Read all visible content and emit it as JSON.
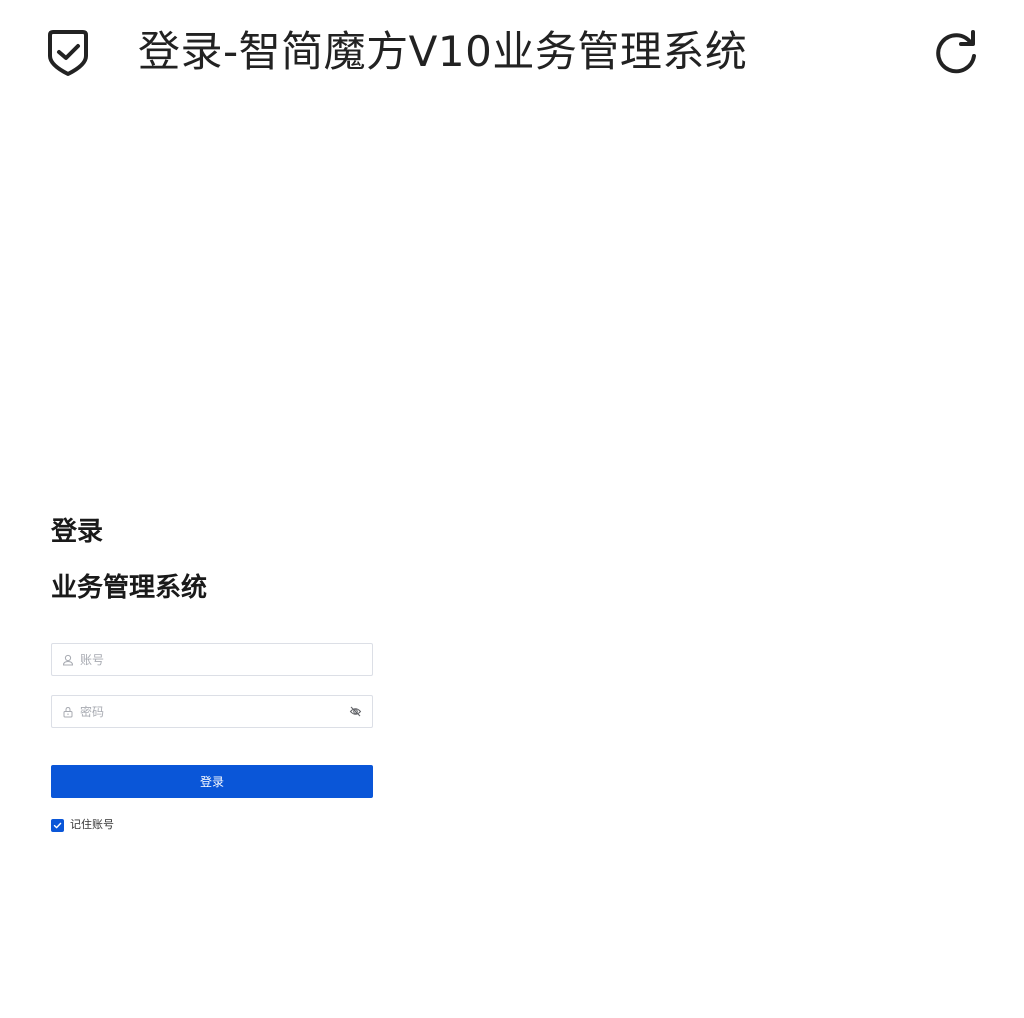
{
  "window": {
    "title": "登录-智简魔方V10业务管理系统",
    "icons": {
      "app": "shield-check-icon",
      "reload": "reload-icon"
    }
  },
  "login": {
    "heading": "登录",
    "subheading": "业务管理系统",
    "account": {
      "placeholder": "账号",
      "value": "",
      "icon": "user-icon"
    },
    "password": {
      "placeholder": "密码",
      "value": "",
      "icon": "lock-icon",
      "toggle_icon": "eye-off-icon"
    },
    "submit_label": "登录",
    "remember": {
      "label": "记住账号",
      "checked": true
    }
  },
  "colors": {
    "primary": "#0a56d8",
    "border": "#dcdfe6",
    "placeholder": "#a8abb2"
  }
}
